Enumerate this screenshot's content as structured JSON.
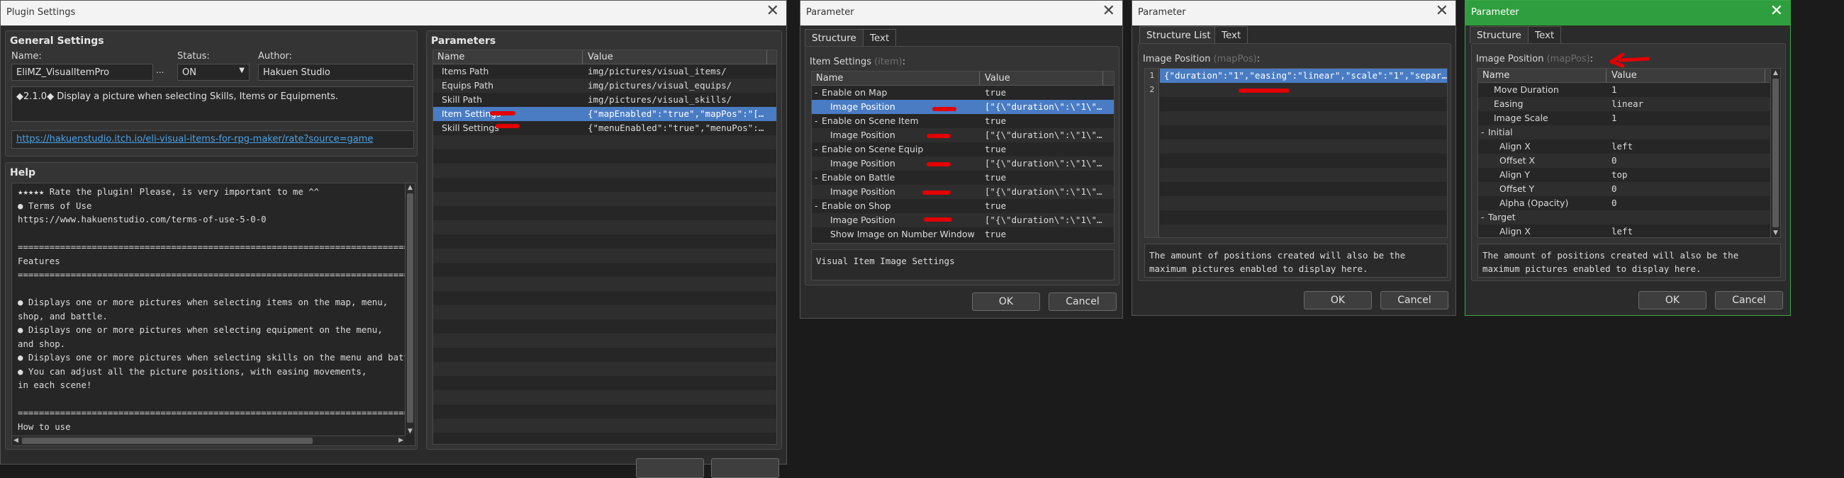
{
  "plugin_settings": {
    "title": "Plugin Settings",
    "general": {
      "title": "General Settings",
      "name_label": "Name:",
      "name_value": "EliMZ_VisualItemPro",
      "name_button": "...",
      "status_label": "Status:",
      "status_value": "ON",
      "author_label": "Author:",
      "author_value": "Hakuen Studio",
      "description": "◆2.1.0◆ Display a picture when selecting Skills, Items or Equipments.",
      "link": "https://hakuenstudio.itch.io/eli-visual-items-for-rpg-maker/rate?source=game"
    },
    "help": {
      "title": "Help",
      "lines": [
        "★★★★★ Rate the plugin! Please, is very important to me ^^",
        "● Terms of Use",
        "https://www.hakuenstudio.com/terms-of-use-5-0-0",
        "",
        "============================================================================",
        "Features",
        "============================================================================",
        "",
        "● Displays one or more pictures when selecting items on the map, menu,",
        "shop, and battle.",
        "● Displays one or more pictures when selecting equipment on the menu,",
        "and shop.",
        "● Displays one or more pictures when selecting skills on the menu and battle.",
        "● You can adjust all the picture positions, with easing movements,",
        "in each scene!",
        "",
        "============================================================================",
        "How to use"
      ]
    },
    "parameters": {
      "title": "Parameters",
      "col_name": "Name",
      "col_value": "Value",
      "rows": [
        {
          "name": "Items Path",
          "value": "img/pictures/visual_items/"
        },
        {
          "name": "Equips Path",
          "value": "img/pictures/visual_equips/"
        },
        {
          "name": "Skill Path",
          "value": "img/pictures/visual_skills/"
        },
        {
          "name": "Item Settings",
          "value": "{\"mapEnabled\":\"true\",\"mapPos\":\"[…"
        },
        {
          "name": "Skill Settings",
          "value": "{\"menuEnabled\":\"true\",\"menuPos\":…"
        }
      ],
      "selected_index": 3
    }
  },
  "param_item": {
    "title": "Parameter",
    "tabs": [
      "Structure",
      "Text"
    ],
    "section_label": "Item Settings",
    "section_key": "(item)",
    "section_colon": ":",
    "col_name": "Name",
    "col_value": "Value",
    "rows": [
      {
        "indent": 0,
        "expander": "-",
        "name": "Enable on Map",
        "value": "true"
      },
      {
        "indent": 1,
        "expander": "",
        "name": "Image Position",
        "value": "[\"{\\\"duration\\\":\\\"1\\\"…",
        "selected": true
      },
      {
        "indent": 0,
        "expander": "-",
        "name": "Enable on Scene Item",
        "value": "true"
      },
      {
        "indent": 1,
        "expander": "",
        "name": "Image Position",
        "value": "[\"{\\\"duration\\\":\\\"1\\\"…"
      },
      {
        "indent": 0,
        "expander": "-",
        "name": "Enable on Scene Equip",
        "value": "true"
      },
      {
        "indent": 1,
        "expander": "",
        "name": "Image Position",
        "value": "[\"{\\\"duration\\\":\\\"1\\\"…"
      },
      {
        "indent": 0,
        "expander": "-",
        "name": "Enable on Battle",
        "value": "true"
      },
      {
        "indent": 1,
        "expander": "",
        "name": "Image Position",
        "value": "[\"{\\\"duration\\\":\\\"1\\\"…"
      },
      {
        "indent": 0,
        "expander": "-",
        "name": "Enable on Shop",
        "value": "true"
      },
      {
        "indent": 1,
        "expander": "",
        "name": "Image Position",
        "value": "[\"{\\\"duration\\\":\\\"1\\\"…"
      },
      {
        "indent": 1,
        "expander": "",
        "name": "Show Image on Number Window",
        "value": "true"
      }
    ],
    "description": "Visual Item Image Settings",
    "ok": "OK",
    "cancel": "Cancel"
  },
  "param_list": {
    "title": "Parameter",
    "tabs": [
      "Structure List",
      "Text"
    ],
    "section_label": "Image Position",
    "section_key": "(mapPos)",
    "section_colon": ":",
    "list_rows": [
      {
        "num": "1",
        "text": "{\"duration\":\"1\",\"easing\":\"linear\",\"scale\":\"1\",\"separ…"
      },
      {
        "num": "2",
        "text": ""
      }
    ],
    "description": "The amount of positions created will also be the maximum pictures enabled to display here.",
    "ok": "OK",
    "cancel": "Cancel"
  },
  "param_struct": {
    "title": "Parameter",
    "tabs": [
      "Structure",
      "Text"
    ],
    "section_label": "Image Position",
    "section_key": "(mapPos)",
    "section_colon": ":",
    "col_name": "Name",
    "col_value": "Value",
    "rows": [
      {
        "indent": 1,
        "expander": "",
        "name": "Move Duration",
        "value": "1"
      },
      {
        "indent": 1,
        "expander": "",
        "name": "Easing",
        "value": "linear"
      },
      {
        "indent": 1,
        "expander": "",
        "name": "Image Scale",
        "value": "1"
      },
      {
        "indent": 0,
        "expander": "-",
        "name": "Initial",
        "value": ""
      },
      {
        "indent": 2,
        "expander": "",
        "name": "Align X",
        "value": "left"
      },
      {
        "indent": 2,
        "expander": "",
        "name": "Offset X",
        "value": "0"
      },
      {
        "indent": 2,
        "expander": "",
        "name": "Align Y",
        "value": "top"
      },
      {
        "indent": 2,
        "expander": "",
        "name": "Offset Y",
        "value": "0"
      },
      {
        "indent": 2,
        "expander": "",
        "name": "Alpha (Opacity)",
        "value": "0"
      },
      {
        "indent": 0,
        "expander": "-",
        "name": "Target",
        "value": ""
      },
      {
        "indent": 2,
        "expander": "",
        "name": "Align X",
        "value": "left"
      }
    ],
    "description": "The amount of positions created will also be the maximum pictures enabled to display here.",
    "ok": "OK",
    "cancel": "Cancel"
  },
  "colors": {
    "selection": "#4a7cc4",
    "annotation_red": "#e30000",
    "active_window_border": "#3aa845",
    "link": "#4aa3e8"
  }
}
